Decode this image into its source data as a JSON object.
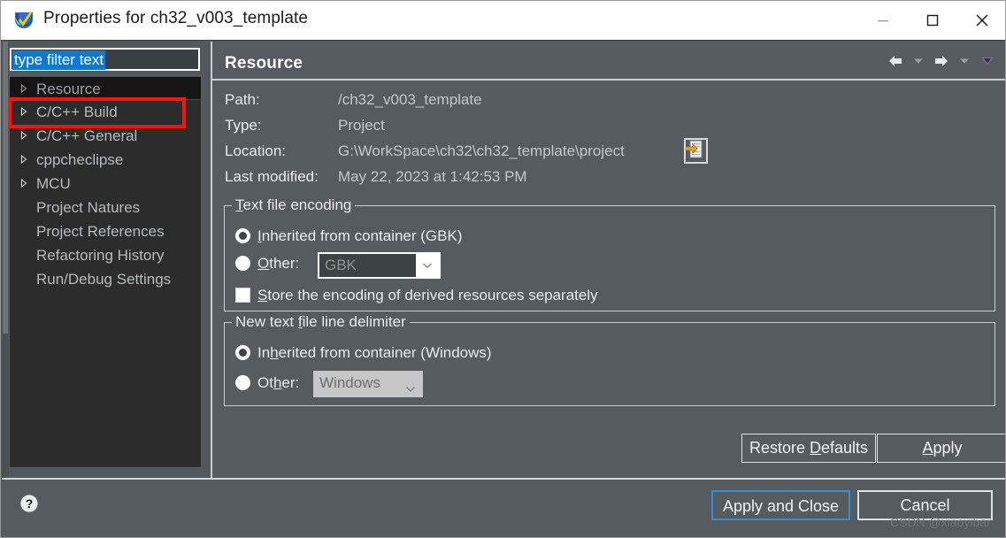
{
  "window": {
    "title": "Properties for ch32_v003_template",
    "icon": "eclipse-properties-icon",
    "controls": {
      "minimize": "minimize-icon",
      "maximize": "maximize-icon",
      "close": "close-icon"
    }
  },
  "sidebar": {
    "filter": {
      "value": "type filter text",
      "placeholder": "type filter text"
    },
    "items": [
      {
        "label": "Resource",
        "expandable": true,
        "selected": true
      },
      {
        "label": "C/C++ Build",
        "expandable": true,
        "selected": false
      },
      {
        "label": "C/C++ General",
        "expandable": true,
        "selected": false
      },
      {
        "label": "cppcheclipse",
        "expandable": true,
        "selected": false
      },
      {
        "label": "MCU",
        "expandable": true,
        "selected": false
      },
      {
        "label": "Project Natures",
        "expandable": false,
        "selected": false
      },
      {
        "label": "Project References",
        "expandable": false,
        "selected": false
      },
      {
        "label": "Refactoring History",
        "expandable": false,
        "selected": false
      },
      {
        "label": "Run/Debug Settings",
        "expandable": false,
        "selected": false
      }
    ],
    "annotation": {
      "target": "C/C++ Build",
      "color": "#f8140b"
    }
  },
  "main": {
    "title": "Resource",
    "nav": {
      "back": "back-arrow-icon",
      "back_menu": "back-dropdown-icon",
      "forward": "forward-arrow-icon",
      "forward_menu": "forward-dropdown-icon",
      "view_menu": "view-menu-icon"
    },
    "properties": [
      {
        "label": "Path:",
        "value": "/ch32_v003_template"
      },
      {
        "label": "Type:",
        "value": "Project"
      },
      {
        "label": "Location:",
        "value": "G:\\WorkSpace\\ch32\\ch32_template\\project"
      },
      {
        "label": "Last modified:",
        "value": "May 22, 2023 at 1:42:53 PM"
      }
    ],
    "location_button": "open-location-icon",
    "encoding_group": {
      "title": "Text file encoding",
      "title_mnemonic": "T",
      "inherited": {
        "label": "Inherited from container (GBK)",
        "mnemonic": "I",
        "checked": true
      },
      "other": {
        "label": "Other:",
        "mnemonic": "O",
        "checked": false,
        "combo_value": "GBK",
        "combo_enabled": false
      },
      "store_separately": {
        "label": "Store the encoding of derived resources separately",
        "mnemonic": "S",
        "checked": false
      }
    },
    "delimiter_group": {
      "title": "New text file line delimiter",
      "title_mnemonic": "f",
      "inherited": {
        "label": "Inherited from container (Windows)",
        "mnemonic": "h",
        "checked": true
      },
      "other": {
        "label": "Other:",
        "mnemonic": "h",
        "checked": false,
        "combo_value": "Windows",
        "combo_enabled": false
      }
    },
    "buttons": {
      "restore_defaults": "Restore Defaults",
      "restore_defaults_mnemonic": "D",
      "apply": "Apply",
      "apply_mnemonic": "A"
    }
  },
  "footer": {
    "help": "help-icon",
    "apply_and_close": "Apply and Close",
    "cancel": "Cancel",
    "watermark": "CSDN @xiaoyibar",
    "focus_color": "#2f8fe0"
  }
}
